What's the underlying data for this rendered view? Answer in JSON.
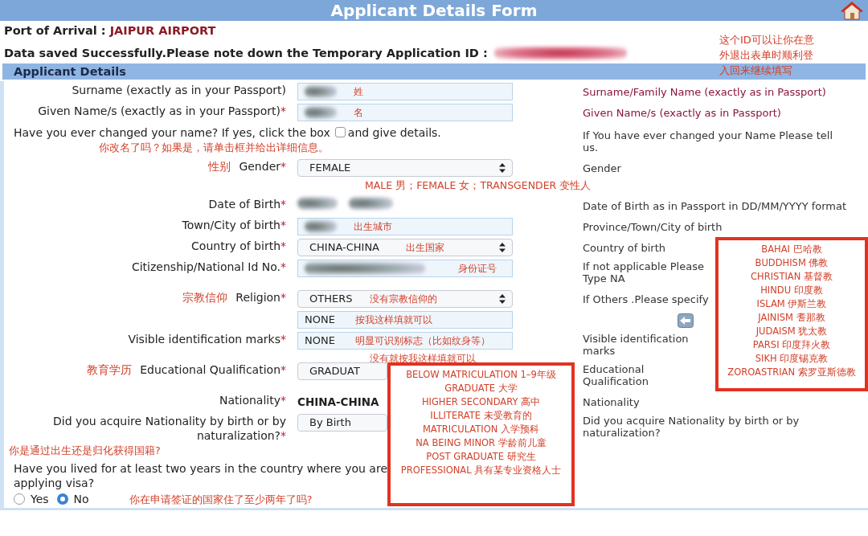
{
  "header": {
    "title": "Applicant Details Form"
  },
  "port": {
    "label": "Port of Arrival :",
    "value": "JAIPUR AIRPORT"
  },
  "saved": {
    "message": "Data saved Successfully.Please note down the Temporary Application ID :",
    "id_redacted": true,
    "annotation": [
      "这个ID可以让你在意",
      "外退出表单时顺利登",
      "入回来继续填写"
    ]
  },
  "section": {
    "title": "Applicant Details"
  },
  "rows": [
    {
      "kind": "field",
      "label": "Surname (exactly as in your Passport)",
      "field": {
        "kind": "text",
        "redacted": true
      },
      "annotation": [
        "姓"
      ],
      "help": "Surname/Family Name (exactly as in Passport)",
      "help_emphasis": true
    },
    {
      "kind": "field",
      "label": "Given Name/s (exactly as in your Passport)",
      "mark": "*",
      "field": {
        "kind": "text",
        "redacted": true
      },
      "annotation": [
        "名"
      ],
      "help": "Given Name/s (exactly as in Passport)",
      "help_emphasis": true
    },
    {
      "kind": "checkbox_question",
      "text_before": "Have you ever changed your name? If yes, click the box",
      "checked": false,
      "text_after": "and give details.",
      "note": "你改名了吗？如果是，请单击框并给出详细信息。",
      "help": "If You have ever changed your Name Please tell us."
    },
    {
      "kind": "field",
      "prefix": "性别",
      "label": "Gender",
      "mark": "*",
      "field": {
        "kind": "select",
        "value": "FEMALE"
      },
      "note": "MALE  男；FEMALE  女；TRANSGENDER  变性人",
      "help": "Gender"
    },
    {
      "kind": "field",
      "label": "Date of Birth",
      "mark": "*",
      "field": {
        "kind": "blank",
        "redacted": true
      },
      "help": "Date of Birth as in Passport in DD/MM/YYYY format"
    },
    {
      "kind": "field",
      "label": "Town/City of birth",
      "mark": "*",
      "field": {
        "kind": "text",
        "redacted": true
      },
      "annotation": [
        "出生城市"
      ],
      "help": "Province/Town/City of birth"
    },
    {
      "kind": "field",
      "label": "Country of birth",
      "mark": "*",
      "field": {
        "kind": "select",
        "value": "CHINA-CHINA"
      },
      "annotation": [
        "出生国家"
      ],
      "help": "Country of birth"
    },
    {
      "kind": "field",
      "label": "Citizenship/National Id No.",
      "mark": "*",
      "field": {
        "kind": "text",
        "redacted": true
      },
      "annotation": [
        "身份证号"
      ],
      "help": "If not applicable Please Type NA"
    },
    {
      "kind": "field",
      "prefix": "宗教信仰",
      "label": "Religion",
      "mark": "*",
      "field": {
        "kind": "select",
        "value": "OTHERS"
      },
      "annotation": [
        "没有宗教信仰的"
      ],
      "help": "If Others .Please specify"
    },
    {
      "kind": "field",
      "field": {
        "kind": "text",
        "value": "NONE"
      },
      "annotation": [
        "按我这样填就可以"
      ],
      "help_icon": true
    },
    {
      "kind": "field",
      "label": "Visible identification marks",
      "mark": "*",
      "field": {
        "kind": "text",
        "value": "NONE"
      },
      "annotation": [
        "明显可识别标志（比如纹身等）",
        "没有就按我这样填就可以"
      ],
      "help": "Visible identification marks"
    },
    {
      "kind": "field",
      "prefix": "教育学历",
      "label": "Educational Qualification",
      "mark": "*",
      "field": {
        "kind": "select",
        "value": "GRADUAT",
        "covered": true
      },
      "help": "Educational Qualification"
    },
    {
      "kind": "field",
      "label": "Nationality",
      "mark": "*",
      "field": {
        "kind": "static",
        "value": "CHINA-CHINA"
      },
      "help": "Nationality"
    },
    {
      "kind": "field",
      "label": "Did you acquire Nationality by birth or by naturalization?",
      "mark": "*",
      "field": {
        "kind": "select",
        "value": "By Birth",
        "covered": true
      },
      "label_note": "你是通过出生还是归化获得国籍?",
      "help": "Did you acquire Nationality by birth or by naturalization?"
    },
    {
      "kind": "radio_question",
      "text": "Have you lived for at least two years in the country where you are applying visa?",
      "options": [
        {
          "label": "Yes",
          "selected": false
        },
        {
          "label": "No",
          "selected": true
        }
      ],
      "note": "你在申请签证的国家住了至少两年了吗?"
    }
  ],
  "religion_box": {
    "items": [
      "BAHAI  巴哈教",
      "BUDDHISM  佛教",
      "CHRISTIAN  基督教",
      "HINDU  印度教",
      "ISLAM  伊斯兰教",
      "JAINISM  耆那教",
      "JUDAISM  犹太教",
      "PARSI  印度拜火教",
      "SIKH  印度锡克教",
      "ZOROASTRIAN  索罗亚斯德教"
    ]
  },
  "education_box": {
    "items": [
      "BELOW MATRICULATION  1–9年级",
      "GRADUATE  大学",
      "HIGHER SECONDARY  高中",
      "ILLITERATE  未受教育的",
      "MATRICULATION  入学预科",
      "NA BEING MINOR  学龄前儿童",
      "POST GRADUATE  研究生",
      "PROFESSIONAL  具有某专业资格人士"
    ]
  }
}
